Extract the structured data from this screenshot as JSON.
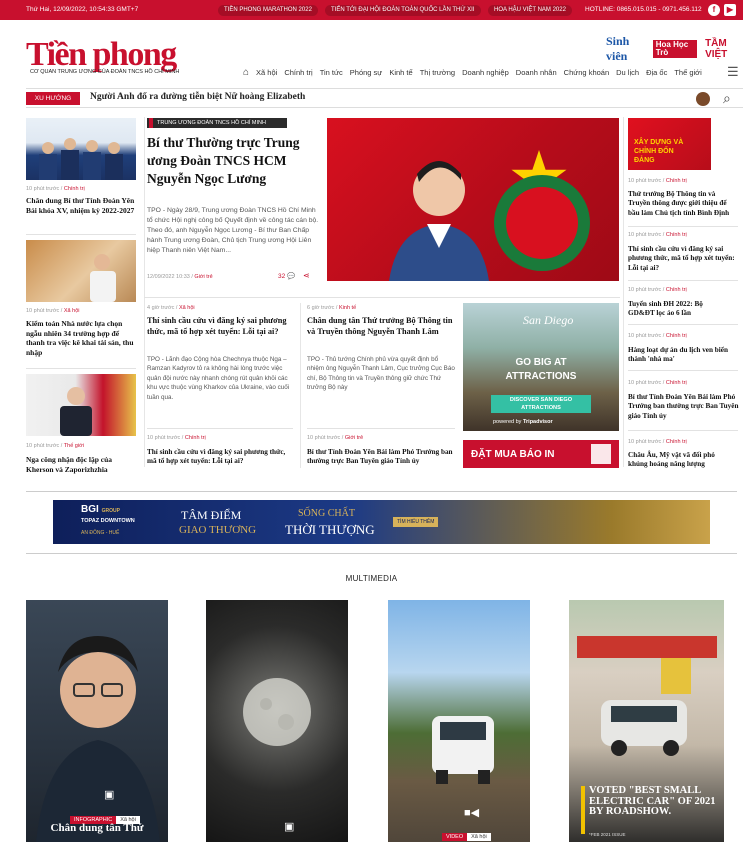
{
  "topbar": {
    "date": "Thứ Hai, 12/09/2022, 10:54:33 GMT+7",
    "links": [
      "TIỀN PHONG MARATHON 2022",
      "TIẾN TỚI ĐẠI HỘI ĐOÀN TOÀN QUỐC LẦN THỨ XII",
      "HOA HẬU VIỆT NAM 2022"
    ],
    "hotline": "HOTLINE: 0865.015.015 - 0971.456.112"
  },
  "header": {
    "logo": "Tiền phong",
    "logo_sub": "CƠ QUAN TRUNG ƯƠNG CỦA ĐOÀN TNCS HỒ CHÍ MINH",
    "partners": [
      "Sinh viên",
      "Hoa Học Trò",
      "TẦM VIỆT"
    ],
    "nav": [
      "Xã hội",
      "Chính trị",
      "Tin tức",
      "Phóng sự",
      "Kinh tế",
      "Thị trường",
      "Doanh nghiệp",
      "Doanh nhân",
      "Chứng khoán",
      "Du lịch",
      "Địa ốc",
      "Thế giới"
    ]
  },
  "trend": {
    "tag": "XU HƯỚNG",
    "text": "Người Anh đổ ra đường tiễn biệt Nữ hoàng Elizabeth"
  },
  "left": [
    {
      "meta": "10 phút trước",
      "cat": "Chính trị",
      "title": "Chân dung Bí thư Tỉnh Đoàn Yên Bái khóa XV, nhiệm kỳ 2022-2027"
    },
    {
      "meta": "10 phút trước",
      "cat": "Xã hội",
      "title": "Kiểm toán Nhà nước lựa chọn ngẫu nhiên 34 trường hợp để thanh tra việc kê khai tài sản, thu nhập"
    },
    {
      "meta": "10 phút trước",
      "cat": "Thế giới",
      "title": "Nga công nhận độc lập của Kherson và Zaporizhzhia"
    }
  ],
  "lead": {
    "tag": "TRUNG ƯƠNG ĐOÀN TNCS HỒ CHÍ MINH",
    "title": "Bí thư Thường trực Trung ương Đoàn TNCS HCM Nguyễn Ngọc Lương",
    "sapo": "TPO - Ngày 28/9, Trung ương Đoàn TNCS Hồ Chí Minh tổ chức Hội nghị công bố Quyết định về công tác cán bộ. Theo đó, anh Nguyễn Ngọc Lương - Bí thư Ban Chấp hành Trung ương Đoàn, Chủ tịch Trung ương Hội Liên hiệp Thanh niên Việt Nam...",
    "time": "12/09/2022 10:33",
    "cat": "Giới trẻ",
    "comments": "32"
  },
  "mid": [
    {
      "meta": "4 giờ trước",
      "cat": "Xã hội",
      "title": "Thí sinh cầu cứu vì đăng ký sai phương thức, mã tổ hợp xét tuyển: Lỗi tại ai?",
      "sapo": "TPO - Lãnh đạo Cộng hòa Chechnya thuộc Nga – Ramzan Kadyrov tỏ ra không hài lòng trước việc quân đội nước này nhanh chóng rút quân khỏi các khu vực thuộc vùng Kharkov của Ukraine, vào cuối tuần qua."
    },
    {
      "meta": "6 giờ trước",
      "cat": "Kinh tế",
      "title": "Chân dung tân Thứ trưởng Bộ Thông tin và Truyền thông Nguyễn Thanh Lâm",
      "sapo": "TPO - Thủ tướng Chính phủ vừa quyết định bổ nhiệm ông Nguyễn Thanh Lâm, Cục trưởng Cục Báo chí, Bộ Thông tin và Truyền thông giữ chức Thứ trưởng Bộ này"
    }
  ],
  "mid_bottom": [
    {
      "meta": "10 phút trước",
      "cat": "Chính trị",
      "title": "Thí sinh cầu cứu vì đăng ký sai phương thức, mã tổ hợp xét tuyển: Lỗi tại ai?"
    },
    {
      "meta": "10 phút trước",
      "cat": "Giới trẻ",
      "title": "Bí thư Tỉnh Đoàn Yên Bái làm Phó Trưởng ban thường trực Ban Tuyên giáo Tỉnh ủy"
    }
  ],
  "ad": {
    "logo": "San Diego",
    "line1": "GO BIG AT",
    "big": "big",
    "line2": "ATTRACTIONS",
    "cta": "DISCOVER SAN DIEGO ATTRACTIONS",
    "powered": "powered by",
    "brand": "Tripadvisor",
    "subscribe": "ĐẶT MUA BÁO IN"
  },
  "right": {
    "image_text": "XÂY DỰNG VÀ CHỈNH ĐỐN ĐẢNG",
    "items": [
      {
        "meta": "10 phút trước",
        "cat": "Chính trị",
        "title": "Thứ trưởng Bộ Thông tin và Truyền thông được giới thiệu để bầu làm Chủ tịch tỉnh Bình Định"
      },
      {
        "meta": "10 phút trước",
        "cat": "Chính trị",
        "title": "Thí sinh cầu cứu vì đăng ký sai phương thức, mã tổ hợp xét tuyển: Lỗi tại ai?"
      },
      {
        "meta": "10 phút trước",
        "cat": "Chính trị",
        "title": "Tuyển sinh ĐH 2022: Bộ GD&ĐT lọc ảo 6 lần"
      },
      {
        "meta": "10 phút trước",
        "cat": "Chính trị",
        "title": "Hàng loạt dự án du lịch ven biển thành 'nhà ma'"
      },
      {
        "meta": "10 phút trước",
        "cat": "Chính trị",
        "title": "Bí thư Tỉnh Đoàn Yên Bái làm Phó Trưởng ban thường trực Ban Tuyên giáo Tỉnh ủy"
      },
      {
        "meta": "10 phút trước",
        "cat": "Chính trị",
        "title": "Châu Âu, Mỹ vật vã đối phó khủng hoảng năng lượng"
      }
    ]
  },
  "banner": {
    "brand": "BGI",
    "group": "GROUP",
    "sub": "TOPAZ DOWNTOWN",
    "loc": "AN ĐÔNG - HUẾ",
    "t1": "TÂM ĐIỂM",
    "t2": "GIAO THƯƠNG",
    "t3": "SỐNG CHẤT",
    "t4": "THỜI THƯỢNG",
    "cta": "TÌM HIỂU THÊM"
  },
  "multimedia": {
    "title": "MULTIMEDIA",
    "cards": [
      {
        "badge1": "INFOGRAPHIC",
        "badge2": "Xã hội",
        "caption": "Chân dung tân Thứ"
      },
      {
        "badge1": "",
        "badge2": "",
        "caption": ""
      },
      {
        "badge1": "VIDEO",
        "badge2": "Xã hội",
        "caption": ""
      },
      {
        "badge1": "",
        "badge2": "",
        "caption": "VOTED \"BEST SMALL ELECTRIC CAR\" OF 2021 BY ROADSHOW.",
        "note": "*FEB 2021 ISSUE"
      }
    ]
  }
}
